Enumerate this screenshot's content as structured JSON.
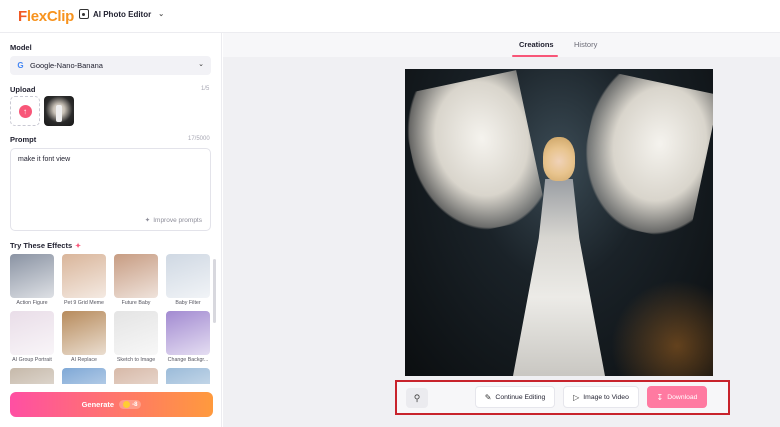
{
  "header": {
    "logo_text_prefix": "F",
    "logo_text_rest": "lexClip",
    "tool_name": "AI Photo Editor"
  },
  "sidebar": {
    "model_label": "Model",
    "model_value": "Google-Nano-Banana",
    "upload_label": "Upload",
    "upload_count": "1/5",
    "prompt_label": "Prompt",
    "prompt_count": "17/5000",
    "prompt_text": "make it font view",
    "improve_label": "Improve prompts",
    "effects_title": "Try These Effects",
    "effects": [
      {
        "label": "Action Figure",
        "color": "#8a93a3"
      },
      {
        "label": "Pet 9 Grid Meme",
        "color": "#d9b59a"
      },
      {
        "label": "Future Baby",
        "color": "#c79c82"
      },
      {
        "label": "Baby Filter",
        "color": "#cfd8e3"
      },
      {
        "label": "AI Group Portrait",
        "color": "#e9dde8"
      },
      {
        "label": "AI Replace",
        "color": "#b78b5c"
      },
      {
        "label": "Sketch to Image",
        "color": "#e4e4e4"
      },
      {
        "label": "Change Backgr...",
        "color": "#a28ad1"
      },
      {
        "label": "",
        "color": "#c6b9aa"
      },
      {
        "label": "",
        "color": "#7fa8d6"
      },
      {
        "label": "",
        "color": "#d7b9a8"
      },
      {
        "label": "",
        "color": "#9bbbd9"
      }
    ],
    "generate_label": "Generate",
    "generate_cost": "-8"
  },
  "main": {
    "tabs": [
      {
        "label": "Creations"
      },
      {
        "label": "History"
      }
    ],
    "actions": {
      "continue_label": "Continue Editing",
      "video_label": "Image to Video",
      "download_label": "Download"
    }
  },
  "colors": {
    "accent": "#f85678",
    "highlight_border": "#c8232c",
    "generate_gradient_start": "#ff4fa3",
    "generate_gradient_end": "#ff9a3d"
  }
}
